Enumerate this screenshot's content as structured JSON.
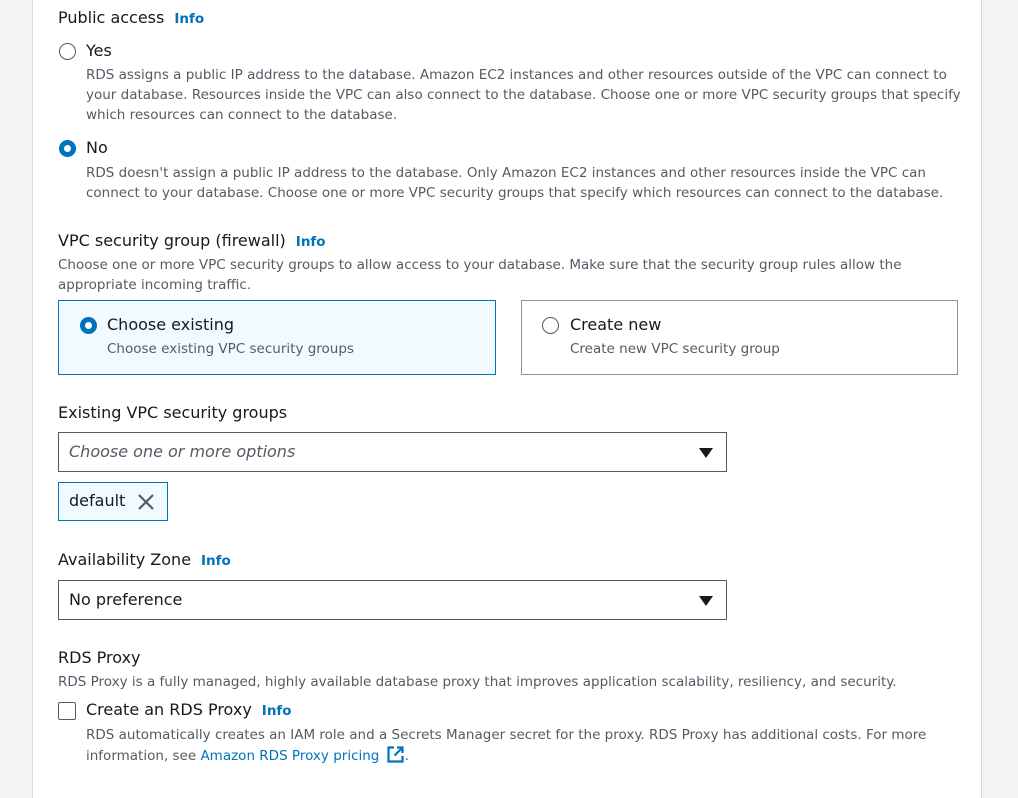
{
  "public_access": {
    "title": "Public access",
    "info": "Info",
    "options": [
      {
        "label": "Yes",
        "description": "RDS assigns a public IP address to the database. Amazon EC2 instances and other resources outside of the VPC can connect to your database. Resources inside the VPC can also connect to the database. Choose one or more VPC security groups that specify which resources can connect to the database.",
        "selected": false
      },
      {
        "label": "No",
        "description": "RDS doesn't assign a public IP address to the database. Only Amazon EC2 instances and other resources inside the VPC can connect to your database. Choose one or more VPC security groups that specify which resources can connect to the database.",
        "selected": true
      }
    ]
  },
  "vpc_security_group": {
    "title": "VPC security group (firewall)",
    "info": "Info",
    "description": "Choose one or more VPC security groups to allow access to your database. Make sure that the security group rules allow the appropriate incoming traffic.",
    "options": [
      {
        "label": "Choose existing",
        "description": "Choose existing VPC security groups",
        "selected": true
      },
      {
        "label": "Create new",
        "description": "Create new VPC security group",
        "selected": false
      }
    ]
  },
  "existing_groups": {
    "title": "Existing VPC security groups",
    "placeholder": "Choose one or more options",
    "tokens": [
      "default"
    ]
  },
  "availability_zone": {
    "title": "Availability Zone",
    "info": "Info",
    "value": "No preference"
  },
  "rds_proxy": {
    "title": "RDS Proxy",
    "description": "RDS Proxy is a fully managed, highly available database proxy that improves application scalability, resiliency, and security.",
    "checkbox_label": "Create an RDS Proxy",
    "info": "Info",
    "checked": false,
    "note_prefix": "RDS automatically creates an IAM role and a Secrets Manager secret for the proxy. RDS Proxy has additional costs. For more information, see ",
    "note_link": "Amazon RDS Proxy pricing",
    "note_suffix": "."
  },
  "colors": {
    "accent": "#0073bb",
    "text": "#16191f",
    "secondary": "#545b64",
    "selected_bg": "#f1faff"
  },
  "icons": {
    "dropdown": "caret-down-icon",
    "remove": "close-icon",
    "external": "external-link-icon"
  }
}
